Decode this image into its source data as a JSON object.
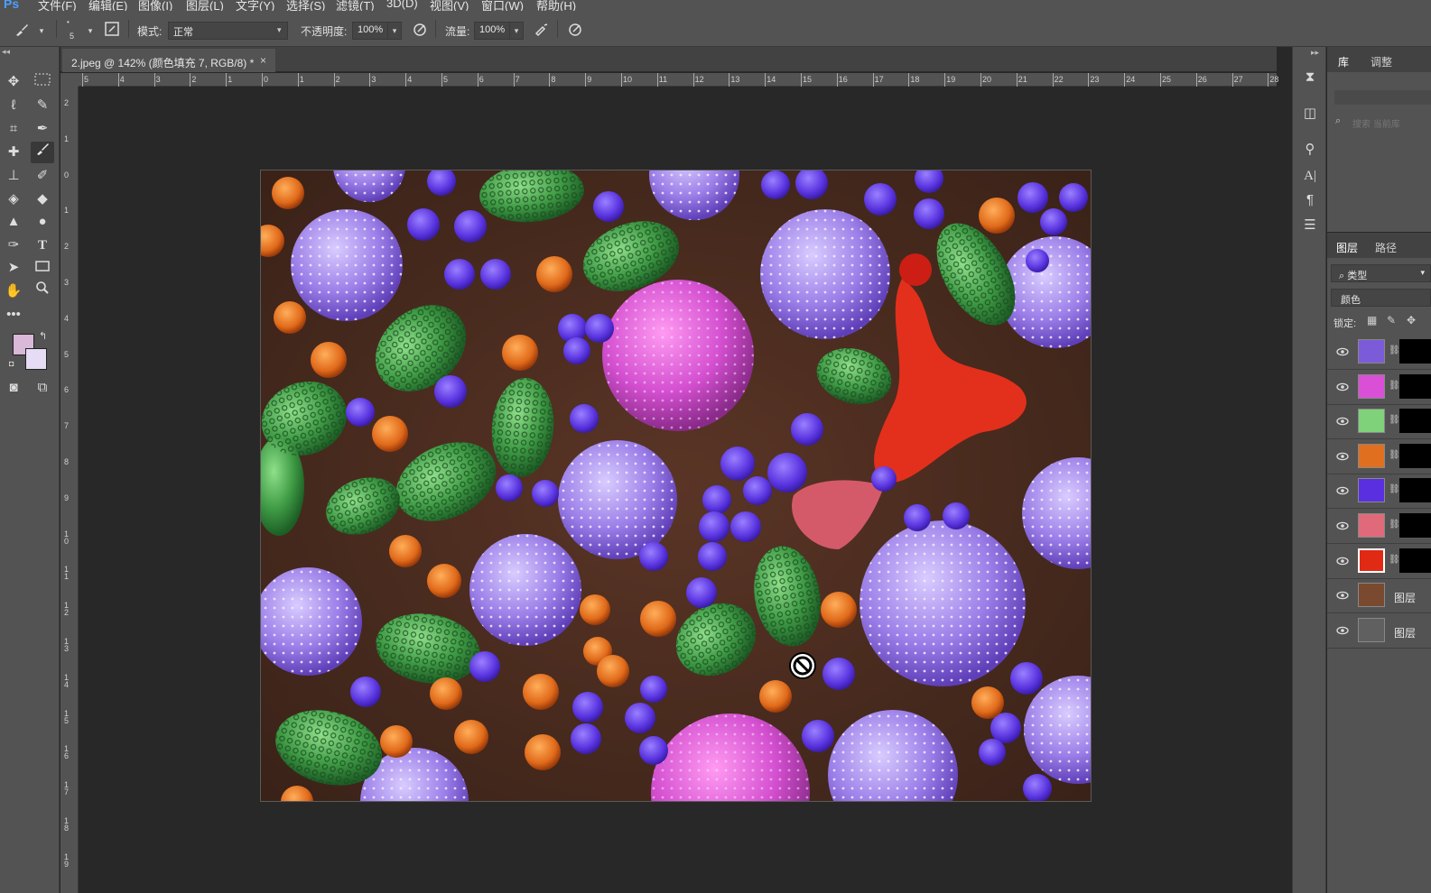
{
  "menubar": {
    "logo": "Ps",
    "items": [
      "文件(F)",
      "编辑(E)",
      "图像(I)",
      "图层(L)",
      "文字(Y)",
      "选择(S)",
      "滤镜(T)",
      "3D(D)",
      "视图(V)",
      "窗口(W)",
      "帮助(H)"
    ]
  },
  "options": {
    "brush_size": "5",
    "mode_label": "模式:",
    "mode_value": "正常",
    "opacity_label": "不透明度:",
    "opacity_value": "100%",
    "flow_label": "流量:",
    "flow_value": "100%"
  },
  "document": {
    "tab_title": "2.jpeg @ 142% (颜色填充 7, RGB/8) *",
    "close": "×",
    "hruler": [
      "5",
      "4",
      "3",
      "2",
      "1",
      "0",
      "1",
      "2",
      "3",
      "4",
      "5",
      "6",
      "7",
      "8",
      "9",
      "10",
      "11",
      "12",
      "13",
      "14",
      "15",
      "16",
      "17",
      "18",
      "19",
      "20",
      "21",
      "22",
      "23",
      "24",
      "25",
      "26",
      "27",
      "28"
    ],
    "vruler": [
      "2",
      "1",
      "0",
      "1",
      "2",
      "3",
      "4",
      "5",
      "6",
      "7",
      "8",
      "9",
      "10",
      "11",
      "12",
      "13",
      "14",
      "15",
      "16",
      "17",
      "18",
      "19"
    ]
  },
  "library_panel": {
    "tabs": [
      "库",
      "调整"
    ],
    "search_placeholder": "搜索 当前库"
  },
  "layers_panel": {
    "tabs": [
      "图层",
      "路径"
    ],
    "filter_label": "类型",
    "blend_label": "颜色",
    "lock_label": "锁定:",
    "layers": [
      {
        "thumb_color": "#7b5bd8",
        "name": ""
      },
      {
        "thumb_color": "#d94fd6",
        "name": ""
      },
      {
        "thumb_color": "#7fd17a",
        "name": ""
      },
      {
        "thumb_color": "#e0701f",
        "name": ""
      },
      {
        "thumb_color": "#5a2fe0",
        "name": ""
      },
      {
        "thumb_color": "#e06a7a",
        "name": ""
      },
      {
        "thumb_color": "#e02a14",
        "name": ""
      },
      {
        "thumb_color": "#7a4a30",
        "name": "图层"
      },
      {
        "thumb_color": "#606060",
        "name": "图层"
      }
    ]
  },
  "colors": {
    "foreground": "#d9b8d8",
    "background": "#e6dcf5"
  }
}
